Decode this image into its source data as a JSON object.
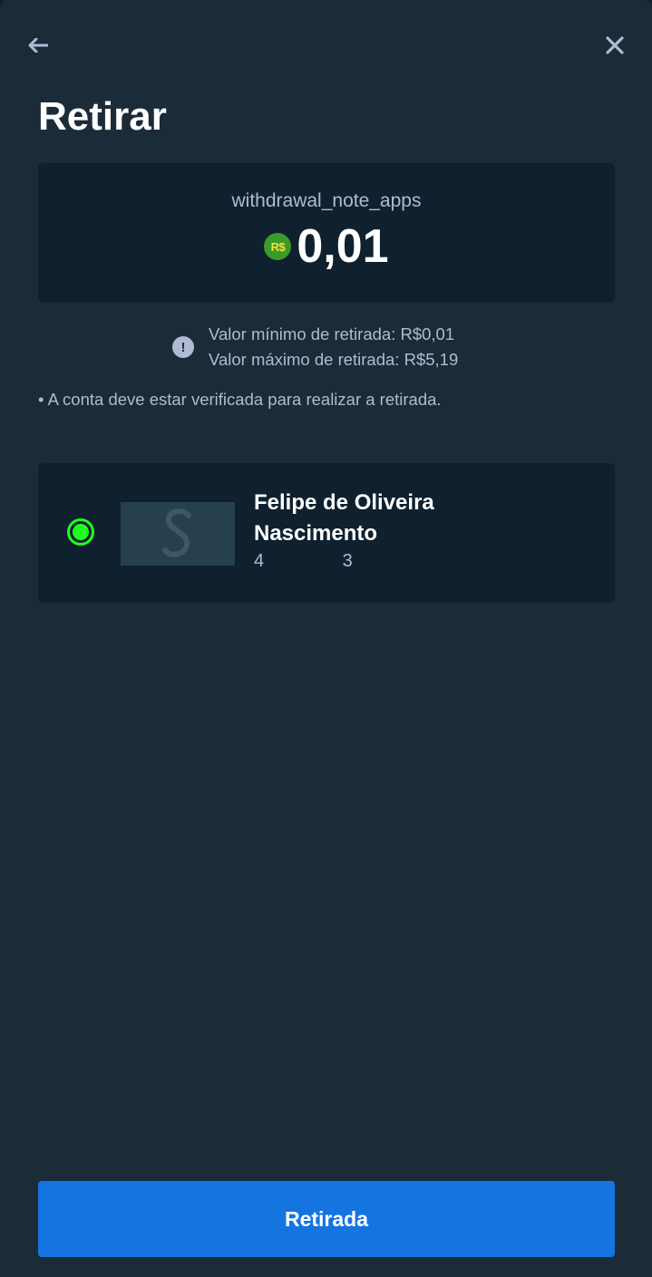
{
  "header": {
    "back_icon": "arrow-left-icon",
    "close_icon": "close-icon",
    "title": "Retirar"
  },
  "amount": {
    "note": "withdrawal_note_apps",
    "currency_symbol": "R$",
    "value": "0,01"
  },
  "limits": {
    "min": "Valor mínimo de retirada: R$0,01",
    "max": "Valor máximo de retirada: R$5,19"
  },
  "verification_note": "• A conta deve estar verificada para realizar a retirada.",
  "account": {
    "selected": true,
    "holder_name": "Felipe de Oliveira Nascimento",
    "number_start": "4",
    "number_end": "3",
    "logo_letter": "S"
  },
  "submit_label": "Retirada",
  "colors": {
    "background": "#1b2b38",
    "card": "#0f212e",
    "selected": "#1fff20",
    "primary_button": "#1475e1",
    "muted_text": "#b1bad3"
  }
}
